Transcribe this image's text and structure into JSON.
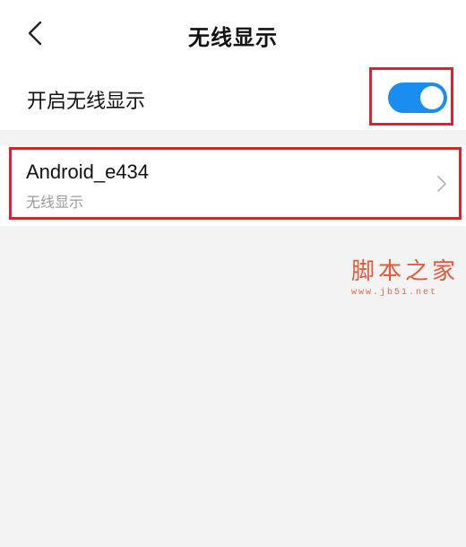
{
  "header": {
    "title": "无线显示"
  },
  "settings": {
    "wireless_display_label": "开启无线显示",
    "wireless_display_enabled": true
  },
  "devices": [
    {
      "name": "Android_e434",
      "subtitle": "无线显示"
    }
  ],
  "watermark": {
    "title": "脚本之家",
    "url": "www.jb51.net"
  },
  "colors": {
    "accent": "#1a8df0",
    "highlight_box": "#d6252f",
    "background": "#f3f3f3",
    "watermark": "#e15a3a"
  },
  "icons": {
    "back": "chevron-left-icon",
    "device_detail": "chevron-right-icon"
  }
}
